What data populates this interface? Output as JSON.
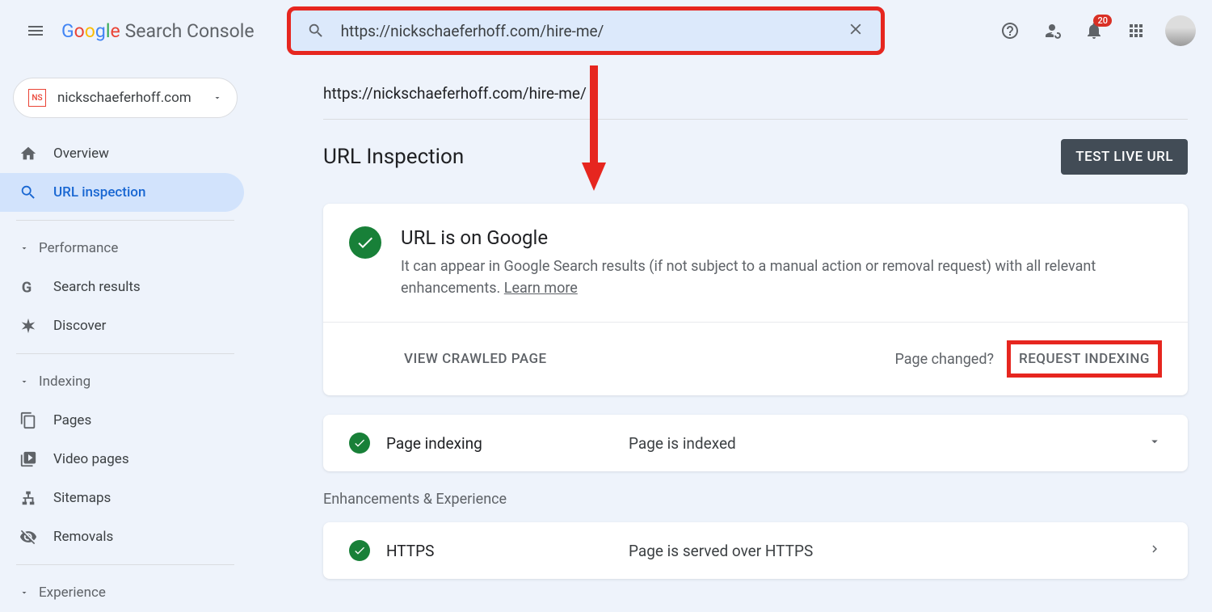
{
  "header": {
    "product_name": "Search Console",
    "search_value": "https://nickschaeferhoff.com/hire-me/",
    "notification_count": "20"
  },
  "sidebar": {
    "property": "nickschaeferhoff.com",
    "overview": "Overview",
    "url_inspection": "URL inspection",
    "section_performance": "Performance",
    "search_results": "Search results",
    "discover": "Discover",
    "section_indexing": "Indexing",
    "pages": "Pages",
    "video_pages": "Video pages",
    "sitemaps": "Sitemaps",
    "removals": "Removals",
    "section_experience": "Experience"
  },
  "main": {
    "url": "https://nickschaeferhoff.com/hire-me/",
    "title": "URL Inspection",
    "test_live": "TEST LIVE URL",
    "status_title": "URL is on Google",
    "status_desc": "It can appear in Google Search results (if not subject to a manual action or removal request) with all relevant enhancements. ",
    "learn_more": "Learn more",
    "view_crawled": "VIEW CRAWLED PAGE",
    "page_changed": "Page changed?",
    "request_indexing": "REQUEST INDEXING",
    "indexing_label": "Page indexing",
    "indexing_value": "Page is indexed",
    "enhancements": "Enhancements & Experience",
    "https_label": "HTTPS",
    "https_value": "Page is served over HTTPS"
  }
}
